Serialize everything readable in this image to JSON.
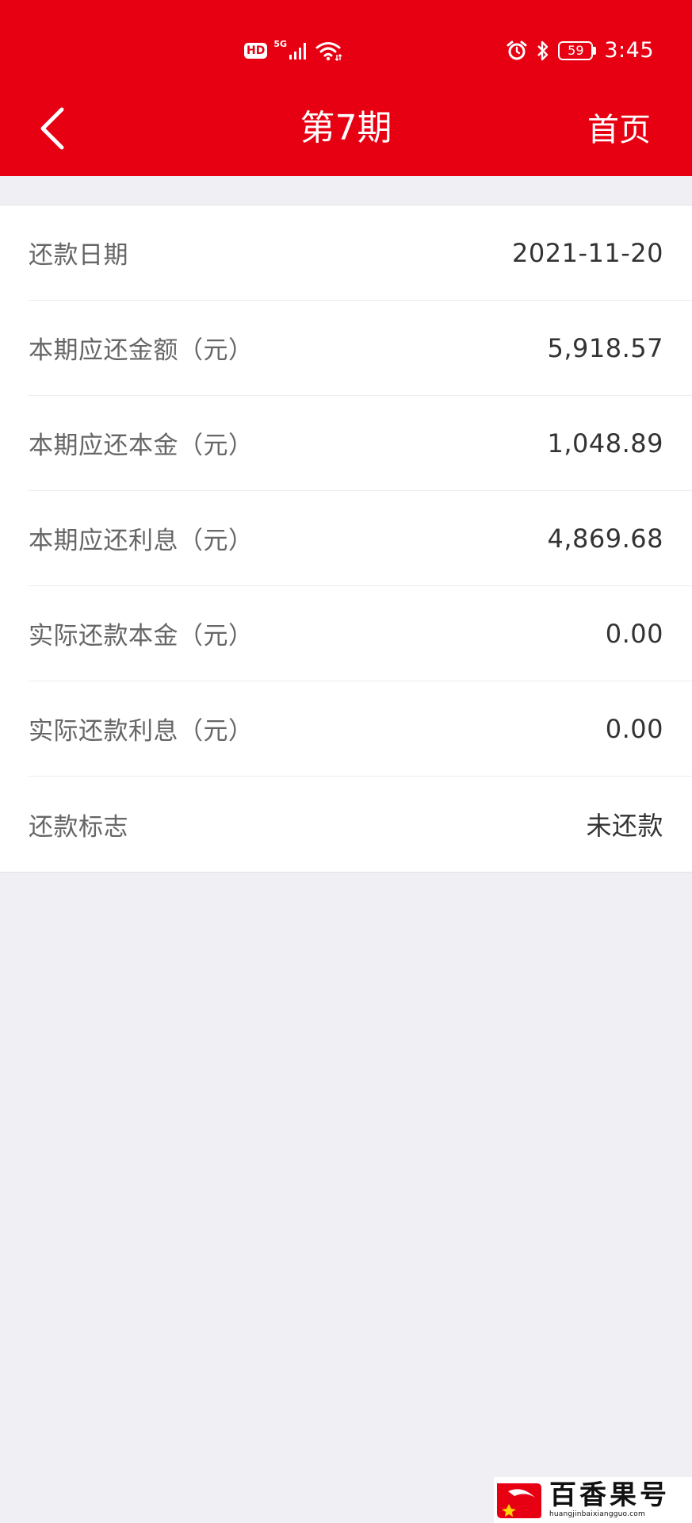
{
  "status_bar": {
    "hd_label": "HD",
    "network_label": "5G",
    "battery_level": "59",
    "time": "3:45",
    "icons": [
      "hd-icon",
      "signal-icon",
      "wifi-icon",
      "alarm-icon",
      "bluetooth-icon",
      "battery-icon"
    ]
  },
  "header": {
    "title": "第7期",
    "home_label": "首页",
    "back_icon": "chevron-left-icon",
    "color": "#e60012"
  },
  "details": [
    {
      "label": "还款日期",
      "value": "2021-11-20"
    },
    {
      "label": "本期应还金额（元）",
      "value": "5,918.57"
    },
    {
      "label": "本期应还本金（元）",
      "value": "1,048.89"
    },
    {
      "label": "本期应还利息（元）",
      "value": "4,869.68"
    },
    {
      "label": "实际还款本金（元）",
      "value": "0.00"
    },
    {
      "label": "实际还款利息（元）",
      "value": "0.00"
    },
    {
      "label": "还款标志",
      "value": "未还款"
    }
  ],
  "watermark": {
    "name": "百香果号",
    "url": "huangjinbaixiangguo.com"
  }
}
